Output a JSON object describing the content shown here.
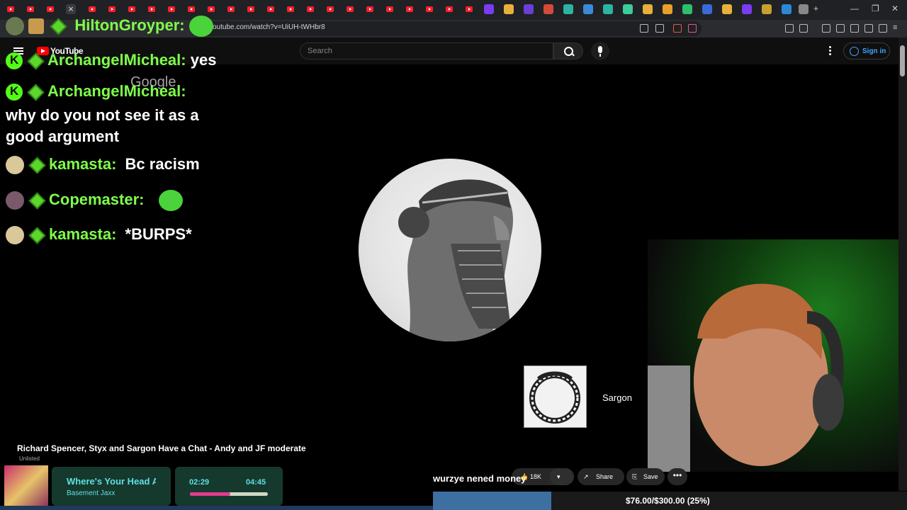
{
  "browser": {
    "url": "youtube.com/watch?v=UiUH-tWHbr8"
  },
  "youtube_header": {
    "wordmark": "YouTube",
    "search_placeholder": "Search",
    "sign_in_label": "Sign in"
  },
  "video": {
    "watermark": "Google",
    "end_card_channel": "Sargon",
    "title": "Richard Spencer, Styx and Sargon Have a Chat - Andy and JF moderate",
    "visibility": "Unlisted",
    "likes": "18K",
    "share_label": "Share",
    "save_label": "Save",
    "more_label": "•••"
  },
  "chat": [
    {
      "user": "HiltonGroyper:",
      "message": ""
    },
    {
      "user": "ArchangelMicheal:",
      "message": "yes"
    },
    {
      "user": "ArchangelMicheal:",
      "message": "why do you not see it as a good argument"
    },
    {
      "user": "kamasta:",
      "message": "Bc racism"
    },
    {
      "user": "Copemaster:",
      "message": ""
    },
    {
      "user": "kamasta:",
      "message": "*BURPS*"
    }
  ],
  "music": {
    "title": "Where's Your Head At",
    "artist": "Basement Jaxx",
    "current_time": "02:29",
    "total_time": "04:45",
    "progress_fraction": 0.52
  },
  "stream": {
    "donation_text": "wurzye nened money",
    "goal_text": "$76.00/$300.00 (25%)",
    "goal_fraction": 0.25
  },
  "colors": {
    "chat_username": "#7fff4a",
    "kick_green": "#53fc18",
    "music_accent": "#5fe0e4",
    "progress_pink": "#e23a8f",
    "signin_blue": "#3ea6ff"
  }
}
